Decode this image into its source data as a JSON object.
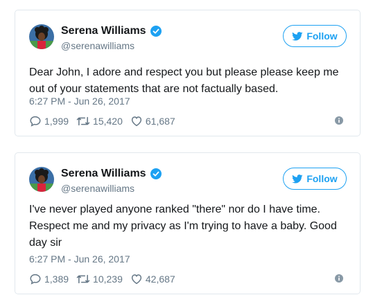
{
  "colors": {
    "accent": "#1da1f2",
    "text_primary": "#14171a",
    "text_secondary": "#657786",
    "border": "#e1e8ed"
  },
  "tweets": [
    {
      "author": {
        "name": "Serena Williams",
        "handle": "@serenawilliams",
        "verified_icon": "verified-badge-icon",
        "avatar_icon": "avatar"
      },
      "follow_label": "Follow",
      "text_lines": [
        "Dear John, I adore and respect you but please please keep me",
        "out of your statements that are not factually based."
      ],
      "timestamp": "6:27 PM - Jun 26, 2017",
      "stats": {
        "replies": "1,999",
        "retweets": "15,420",
        "likes": "61,687"
      }
    },
    {
      "author": {
        "name": "Serena Williams",
        "handle": "@serenawilliams",
        "verified_icon": "verified-badge-icon",
        "avatar_icon": "avatar"
      },
      "follow_label": "Follow",
      "text_lines": [
        "I've never played anyone ranked \"there\" nor do I have time.",
        "Respect me and my privacy as I'm trying to have a baby. Good",
        "day sir"
      ],
      "timestamp": "6:27 PM - Jun 26, 2017",
      "stats": {
        "replies": "1,389",
        "retweets": "10,239",
        "likes": "42,687"
      }
    }
  ]
}
